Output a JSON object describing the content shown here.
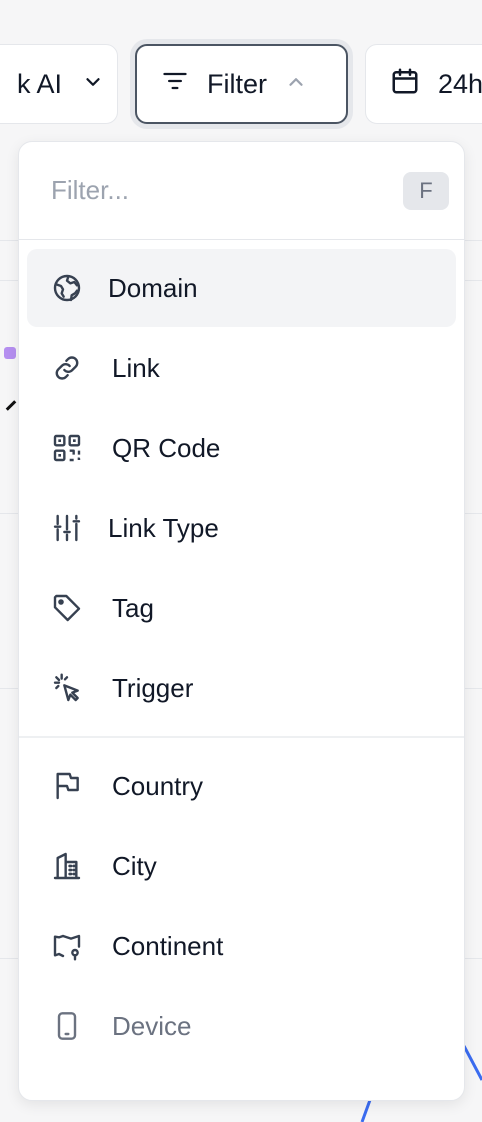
{
  "toolbar": {
    "ai_label": "k AI",
    "filter_label": "Filter",
    "date_label": "24h"
  },
  "filter_menu": {
    "search_placeholder": "Filter...",
    "shortcut_key": "F",
    "groups": [
      {
        "items": [
          {
            "label": "Domain",
            "icon": "globe-icon",
            "active": true
          },
          {
            "label": "Link",
            "icon": "link-icon"
          },
          {
            "label": "QR Code",
            "icon": "qr-code-icon"
          },
          {
            "label": "Link Type",
            "icon": "sliders-icon"
          },
          {
            "label": "Tag",
            "icon": "tag-icon"
          },
          {
            "label": "Trigger",
            "icon": "cursor-click-icon"
          }
        ]
      },
      {
        "items": [
          {
            "label": "Country",
            "icon": "flag-icon"
          },
          {
            "label": "City",
            "icon": "building-icon"
          },
          {
            "label": "Continent",
            "icon": "map-pin-icon"
          },
          {
            "label": "Device",
            "icon": "mobile-icon",
            "disabled": true
          }
        ]
      }
    ]
  },
  "colors": {
    "accent_border": "#4b5563",
    "active_row": "#f3f4f6",
    "chart_marker": "#b58ff0",
    "chart_line": "#3b6cf0"
  }
}
